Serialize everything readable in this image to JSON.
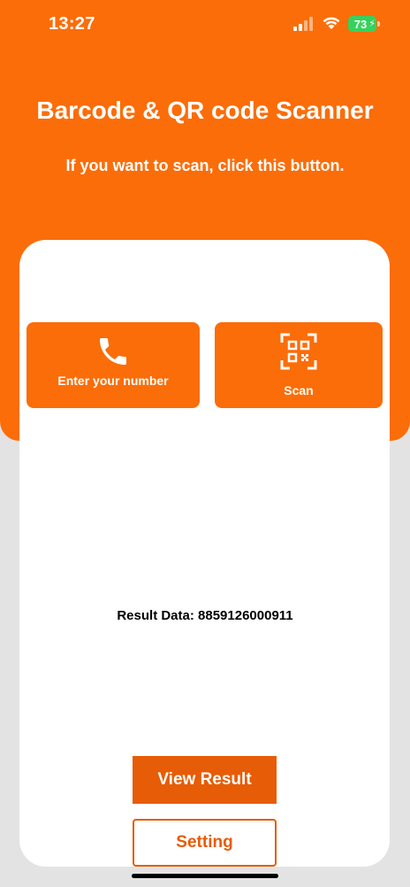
{
  "status_bar": {
    "time": "13:27",
    "battery": "73",
    "icons": [
      "cellular-signal-icon",
      "wifi-icon",
      "battery-charging-icon"
    ]
  },
  "header": {
    "title": "Barcode & QR code Scanner",
    "subtitle": "If you want to scan, click this button."
  },
  "actions": {
    "phone": {
      "label": "Enter your number",
      "icon": "phone-icon"
    },
    "scan": {
      "label": "Scan",
      "icon": "qr-scan-icon"
    }
  },
  "result": {
    "text": "Result Data: 8859126000911"
  },
  "buttons": {
    "view_result": "View Result",
    "setting": "Setting"
  },
  "colors": {
    "accent": "#fb6d09",
    "button_dark": "#e75c06",
    "background": "#e3e3e3",
    "card": "#ffffff",
    "battery": "#36d15c"
  }
}
